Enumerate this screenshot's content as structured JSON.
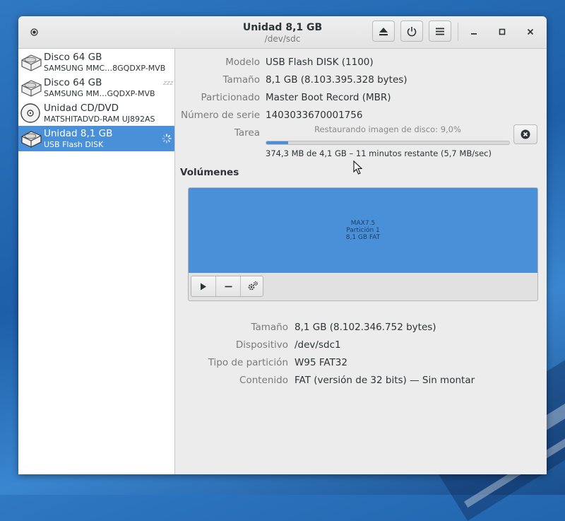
{
  "window": {
    "title": "Unidad 8,1 GB",
    "subtitle": "/dev/sdc"
  },
  "header_buttons": {
    "eject_icon": "eject-icon",
    "power_icon": "power-icon",
    "menu_icon": "hamburger-menu-icon",
    "minimize_icon": "minimize-icon",
    "maximize_icon": "maximize-icon",
    "close_icon": "close-icon"
  },
  "sidebar": {
    "drives": [
      {
        "name": "Disco 64 GB",
        "model": "SAMSUNG MMC…8GQDXP-MVB",
        "icon": "hard-disk-icon",
        "state": ""
      },
      {
        "name": "Disco 64 GB",
        "model": "SAMSUNG MM…GQDXP-MVB",
        "icon": "hard-disk-icon",
        "state": "zzz"
      },
      {
        "name": "Unidad CD/DVD",
        "model": "MATSHITADVD-RAM UJ892AS",
        "icon": "optical-disc-icon",
        "state": ""
      },
      {
        "name": "Unidad 8,1 GB",
        "model": "USB Flash DISK",
        "icon": "usb-drive-icon",
        "state": "busy"
      }
    ]
  },
  "drive_info": {
    "model_label": "Modelo",
    "model_value": "USB Flash DISK (1100)",
    "size_label": "Tamaño",
    "size_value": "8,1 GB (8.103.395.328 bytes)",
    "partitioning_label": "Particionado",
    "partitioning_value": "Master Boot Record (MBR)",
    "serial_label": "Número de serie",
    "serial_value": "1403033670001756",
    "task_label": "Tarea",
    "task_text": "Restaurando imagen de disco: 9,0%",
    "task_progress": 0.09,
    "task_detail": "374,3 MB de 4,1 GB – 11 minutos restante (5,7 MB/sec)",
    "cancel_icon": "cancel-icon"
  },
  "volumes": {
    "title": "Volúmenes",
    "partition": {
      "line1": "MAX7.5",
      "line2": "Partición 1",
      "line3": "8,1 GB FAT"
    },
    "toolbar": {
      "play_icon": "play-icon",
      "minus_icon": "minus-icon",
      "gears_icon": "gears-icon"
    },
    "details": {
      "size_label": "Tamaño",
      "size_value": "8,1 GB (8.102.346.752 bytes)",
      "device_label": "Dispositivo",
      "device_value": "/dev/sdc1",
      "ptype_label": "Tipo de partición",
      "ptype_value": "W95 FAT32",
      "contents_label": "Contenido",
      "contents_value": "FAT (versión de 32 bits) — Sin montar"
    }
  },
  "colors": {
    "accent": "#4a90d9",
    "window_bg": "#ececec",
    "sidebar_bg": "#ffffff"
  }
}
